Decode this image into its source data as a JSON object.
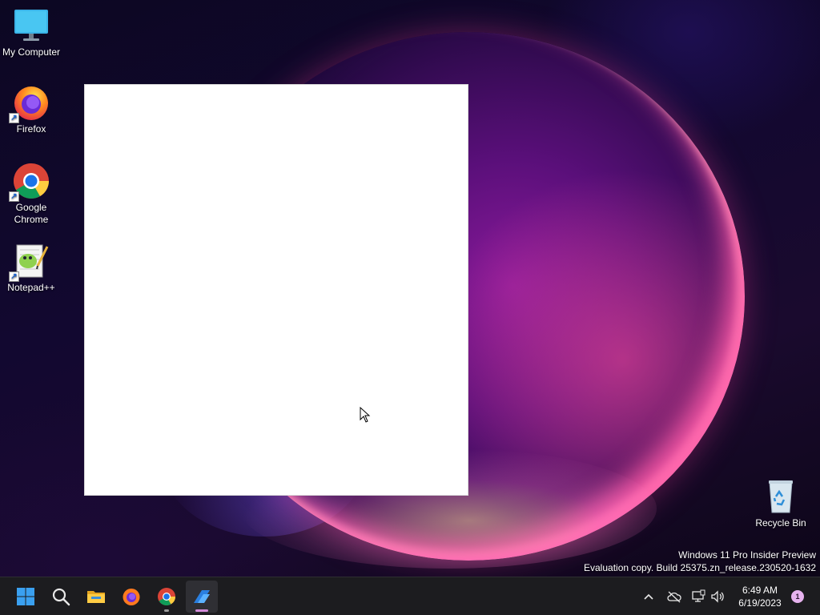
{
  "desktop": {
    "icons": [
      {
        "label": "My Computer",
        "icon": "monitor-icon"
      },
      {
        "label": "Firefox",
        "icon": "firefox-icon"
      },
      {
        "label": "Google Chrome",
        "icon": "chrome-icon"
      },
      {
        "label": "Notepad++",
        "icon": "notepadpp-icon"
      },
      {
        "label": "Recycle Bin",
        "icon": "recycle-bin-icon"
      }
    ],
    "watermark": {
      "line1": "Windows 11 Pro Insider Preview",
      "line2": "Evaluation copy. Build 25375.zn_release.230520-1632"
    }
  },
  "taskbar": {
    "apps": [
      {
        "name": "Start",
        "icon": "windows-start-icon"
      },
      {
        "name": "Search",
        "icon": "search-icon"
      },
      {
        "name": "File Explorer",
        "icon": "folder-icon"
      },
      {
        "name": "Firefox",
        "icon": "firefox-icon"
      },
      {
        "name": "Google Chrome",
        "icon": "chrome-icon",
        "running": true
      },
      {
        "name": "Power Automate",
        "icon": "power-automate-icon",
        "active": true
      }
    ],
    "tray": {
      "icons": [
        "chevron-up-icon",
        "cloud-offline-icon",
        "network-icon",
        "volume-icon"
      ],
      "time": "6:49 AM",
      "date": "6/19/2023",
      "notification_count": "1"
    }
  },
  "colors": {
    "taskbar_bg": "#1c1c1f",
    "accent_active": "#d28ad8",
    "notification_badge": "#e7b3ef"
  }
}
